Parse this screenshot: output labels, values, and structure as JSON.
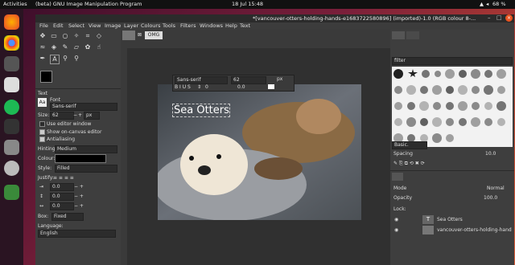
{
  "topbar": {
    "activities": "Activities",
    "app": "(beta) GNU Image Manipulation Program",
    "clock": "18 Jul  15:48",
    "battery": "68 %"
  },
  "window": {
    "title": "*[vancouver-otters-holding-hands-e1683722580896] (imported)-1.0 (RGB colour 8-..."
  },
  "menu": [
    "File",
    "Edit",
    "Select",
    "View",
    "Image",
    "Layer",
    "Colours",
    "Tools",
    "Filters",
    "Windows",
    "Help",
    "Text"
  ],
  "tab": {
    "label": "OMG"
  },
  "toolbox": {
    "section": "Text",
    "font_label": "Font",
    "font_value": "Sans-serif",
    "size_label": "Size:",
    "size_value": "62",
    "size_unit": "px",
    "use_editor": "Use editor window",
    "show_onscreen": "Show on-canvas editor",
    "antialias": "Antialiasing",
    "hinting_label": "Hinting:",
    "hinting_value": "Medium",
    "colour_label": "Colour:",
    "style_label": "Style:",
    "style_value": "Filled",
    "justify_label": "Justify:",
    "indent_value": "0.0",
    "linespace_value": "0.0",
    "letterspace_value": "0.0",
    "box_label": "Box:",
    "box_value": "Fixed",
    "language_label": "Language:",
    "language_value": "English"
  },
  "text_toolbar": {
    "font": "Sans-serif",
    "size": "62",
    "unit": "px",
    "baseline": "0",
    "kerning": "0.0"
  },
  "canvas_text": "Sea Otters",
  "brushes": {
    "filter_placeholder": "filter",
    "preset": "Basic.",
    "spacing_label": "Spacing",
    "spacing_value": "10.0"
  },
  "layers": {
    "mode_label": "Mode",
    "mode_value": "Normal",
    "opacity_label": "Opacity",
    "opacity_value": "100.0",
    "lock_label": "Lock:",
    "items": [
      "Sea Otters",
      "vancouver-otters-holding-hand"
    ]
  },
  "colors": {
    "fg": "#000000",
    "bg": "#ffffff",
    "text_colour": "#000000"
  }
}
